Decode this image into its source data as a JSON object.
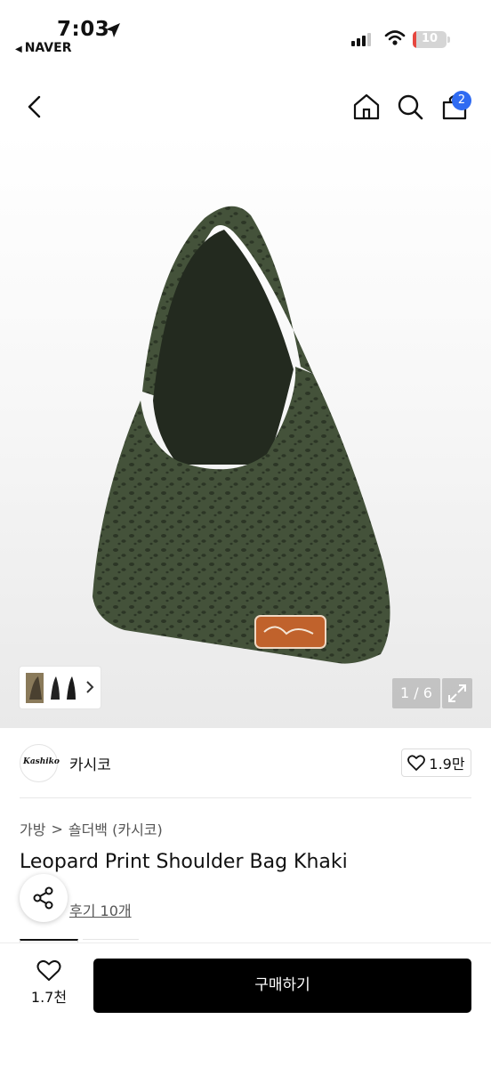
{
  "status_bar": {
    "time": "7:03",
    "back_app": "NAVER",
    "battery": "10",
    "battery_level": 0.1
  },
  "header": {
    "cart_count": "2",
    "icons": [
      "back-icon",
      "home-icon",
      "search-icon",
      "shopping-bag-icon"
    ]
  },
  "gallery": {
    "counter": "1 / 6"
  },
  "brand": {
    "logo_text": "Kashiko",
    "name": "카시코",
    "likes": "1.9만"
  },
  "breadcrumb": {
    "category": "가방",
    "separator": ">",
    "subcategory": "숄더백 (카시코)"
  },
  "product": {
    "title": "Leopard Print Shoulder Bag Khaki",
    "reviews": "후기 10개"
  },
  "bottom_bar": {
    "wish_count": "1.7천",
    "buy_label": "구매하기"
  },
  "colors": {
    "accent": "#2f6bf2",
    "buy_button": "#000000",
    "bag_khaki": "#3f4d35",
    "patch_orange": "#c0622c"
  }
}
